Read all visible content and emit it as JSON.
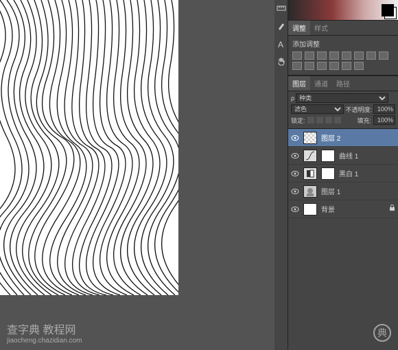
{
  "tools": [
    "ruler",
    "pencil",
    "text",
    "hand"
  ],
  "panel": {
    "tabs": {
      "adjust": "调整",
      "style": "样式"
    },
    "adjustments_title": "添加调整",
    "adj_icons": [
      "brightness",
      "levels",
      "curves",
      "exposure",
      "vibrance",
      "hsl",
      "bw",
      "photo-filter",
      "channel-mixer",
      "lookup",
      "posterize",
      "threshold",
      "gradient-map",
      "selective"
    ]
  },
  "layers": {
    "tabs": {
      "layers": "图层",
      "channels": "通道",
      "paths": "路径"
    },
    "kind_label": "种类",
    "blend_mode": "滤色",
    "opacity_label": "不透明度:",
    "opacity_value": "100%",
    "lock_label": "锁定:",
    "fill_label": "填充:",
    "fill_value": "100%",
    "items": [
      {
        "name": "图层 2",
        "type": "checker",
        "selected": true,
        "adj": false
      },
      {
        "name": "曲线 1",
        "type": "adj",
        "selected": false,
        "adj": true,
        "icon": "curves"
      },
      {
        "name": "黑白 1",
        "type": "adj",
        "selected": false,
        "adj": true,
        "icon": "bw"
      },
      {
        "name": "图层 1",
        "type": "face",
        "selected": false,
        "adj": false
      },
      {
        "name": "背景",
        "type": "white",
        "selected": false,
        "adj": false,
        "locked": true
      }
    ]
  },
  "watermark": {
    "brand": "查字典 教程网",
    "url": "jiaocheng.chazidian.com",
    "logo": "典"
  }
}
